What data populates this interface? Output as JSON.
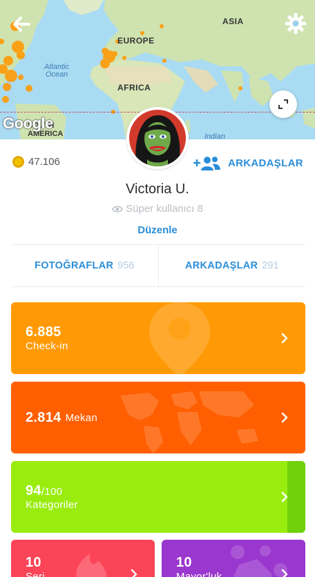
{
  "map": {
    "labels": {
      "asia": "ASIA",
      "europe": "EUROPE",
      "africa": "AFRICA",
      "atlantic_line1": "Atlantic",
      "atlantic_line2": "Ocean",
      "indian": "Indian",
      "south_america": "SOUTH AMERICA"
    },
    "google_logo": "Google",
    "land_color": "#cfe3b0",
    "water_color": "#a9dbf3",
    "marker_color": "#ff9a06"
  },
  "icons": {
    "back": "arrow-left-icon",
    "settings": "gear-icon",
    "expand": "expand-icon",
    "coin": "coin-icon",
    "add_friends": "add-friends-icon",
    "superuser": "eye-badge-icon",
    "chevron": "chevron-right-icon"
  },
  "profile": {
    "coins": "47.106",
    "add_friends_label": "ARKADAŞLAR",
    "name": "Victoria U.",
    "superuser_label": "Süper kullanıcı 8",
    "edit_label": "Düzenle"
  },
  "tabs": [
    {
      "label": "FOTOĞRAFLAR",
      "count": "956"
    },
    {
      "label": "ARKADAŞLAR",
      "count": "291"
    }
  ],
  "stats": {
    "checkin": {
      "value": "6.885",
      "label": "Check-in",
      "color": "#ff9a06"
    },
    "venues": {
      "value": "2.814",
      "label": "Mekan",
      "color": "#ff5f00"
    },
    "categories": {
      "value": "94",
      "total": "/100",
      "label": "Kategoriler",
      "progress": 0.94,
      "color": "#8ee10c"
    },
    "streak": {
      "value": "10",
      "label": "Seri",
      "color": "#fc4458"
    },
    "mayor": {
      "value": "10",
      "label": "Mayor'luk",
      "color": "#9a37ce"
    }
  },
  "colors": {
    "accent_blue": "#2a8ed8",
    "muted_text": "#b9bec4"
  }
}
